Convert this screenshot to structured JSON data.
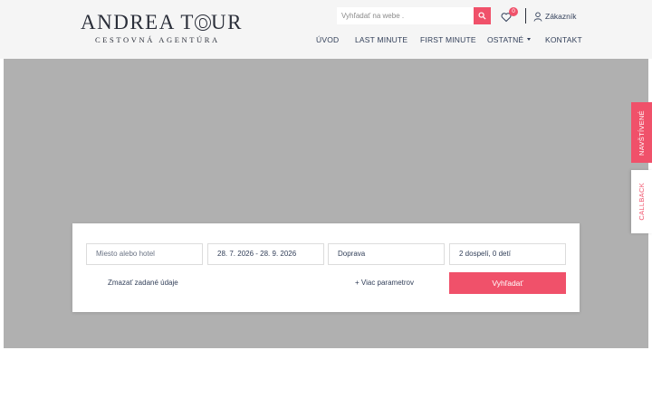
{
  "logo": {
    "main_left": "ANDREA T",
    "main_right": "UR",
    "sub": "CESTOVNÁ AGENTÚRA"
  },
  "search": {
    "placeholder": "Vyhľadať na webe ."
  },
  "favorites": {
    "count": "0"
  },
  "customer": {
    "label": "Zákazník"
  },
  "nav": {
    "items": [
      {
        "label": "ÚVOD"
      },
      {
        "label": "LAST MINUTE"
      },
      {
        "label": "FIRST MINUTE"
      },
      {
        "label": "OSTATNÉ"
      },
      {
        "label": "KONTAKT"
      }
    ]
  },
  "side_tabs": {
    "visited": "NAVŠTÍVENÉ",
    "callback": "CALLBACK"
  },
  "search_panel": {
    "destination_placeholder": "Miesto alebo hotel",
    "dates": "28. 7. 2026 - 28. 9. 2026",
    "transport": "Doprava",
    "travelers": "2 dospelí, 0 detí",
    "clear_label": "Zmazať zadané údaje",
    "more_params_label": "+ Viac parametrov",
    "submit_label": "Vyhľadať"
  },
  "colors": {
    "accent": "#f0516a",
    "header_bg": "#f5f5f5",
    "hero_bg": "#b0b0b0",
    "text": "#33405a"
  },
  "icons": {
    "search": "search-icon",
    "favorites": "heart-icon",
    "customer": "user-icon",
    "dropdown": "chevron-down-icon"
  }
}
